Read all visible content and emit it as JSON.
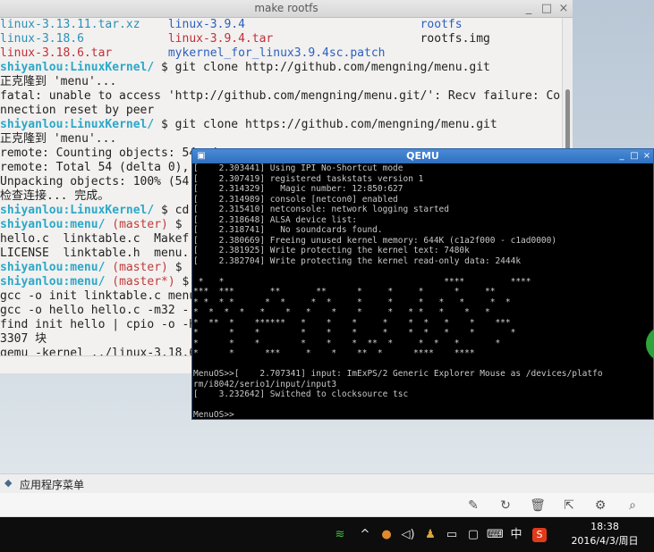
{
  "terminal": {
    "title": "make rootfs",
    "ls_rows": [
      [
        "linux-3.13.11.tar.xz",
        "linux-3.9.4",
        "rootfs"
      ],
      [
        "linux-3.18.6",
        "linux-3.9.4.tar",
        "rootfs.img"
      ],
      [
        "linux-3.18.6.tar",
        "mykernel_for_linux3.9.4sc.patch",
        ""
      ]
    ],
    "lines": [
      {
        "user": "shiyanlou",
        "path": "LinuxKernel/",
        "branch": "",
        "cmd": " $ git clone http://github.com/mengning/menu.git"
      },
      {
        "text": "正克隆到 'menu'..."
      },
      {
        "text": "fatal: unable to access 'http://github.com/mengning/menu.git/': Recv failure: Co"
      },
      {
        "text": "nnection reset by peer"
      },
      {
        "user": "shiyanlou",
        "path": "LinuxKernel/",
        "branch": "",
        "cmd": " $ git clone https://github.com/mengning/menu.git"
      },
      {
        "text": "正克隆到 'menu'..."
      },
      {
        "text": "remote: Counting objects: 54, done."
      },
      {
        "text": "remote: Total 54 (delta 0),"
      },
      {
        "text": "Unpacking objects: 100% (54"
      },
      {
        "text": "检查连接... 完成。"
      },
      {
        "user": "shiyanlou",
        "path": "LinuxKernel/",
        "branch": "",
        "cmd": " $ cd"
      },
      {
        "user": "shiyanlou",
        "path": "menu/",
        "branch": "(master)",
        "cmd": " $"
      },
      {
        "text": "hello.c  linktable.c  Makef"
      },
      {
        "text": "LICENSE  linktable.h  menu."
      },
      {
        "user": "shiyanlou",
        "path": "menu/",
        "branch": "(master)",
        "cmd": " $ "
      },
      {
        "user": "shiyanlou",
        "path": "menu/",
        "branch": "(master*)",
        "cmd": " $ m"
      },
      {
        "text": "gcc -o init linktable.c menu"
      },
      {
        "text": "gcc -o hello hello.c -m32 -"
      },
      {
        "text": "find init hello | cpio -o -H"
      },
      {
        "text": "3307 块"
      },
      {
        "text": "qemu -kernel ../linux-3.18.6"
      }
    ]
  },
  "qemu": {
    "title": "QEMU",
    "boot_lines": [
      "[    2.303441] Using IPI No-Shortcut mode",
      "[    2.307419] registered taskstats version 1",
      "[    2.314329]   Magic number: 12:850:627",
      "[    2.314989] console [netcon0] enabled",
      "[    2.315410] netconsole: network logging started",
      "[    2.318648] ALSA device list:",
      "[    2.318741]   No soundcards found.",
      "[    2.380669] Freeing unused kernel memory: 644K (c1a2f000 - c1ad0000)",
      "[    2.381925] Write protecting the kernel text: 7480k",
      "[    2.382704] Write protecting the kernel read-only data: 2444k"
    ],
    "art_lines": [
      " *   *                                           ****         ****",
      "***  ***       **       **      *     *     *      *     **",
      "* *  * *      *  *     *  *     *     *     *   *   *     *  *",
      "*  *  *  *   *    *   *    *    *     *   * *   *    *   *",
      "*  **  *    ******   *    *    *     *    *  *   *    *    ***",
      "*      *    *        *    *    *     *    *  *   *    *       *",
      "*      *    *        *    *    *  **  *     *  *   *       *",
      "*      *      ***     *    *    **  *      ****    ****"
    ],
    "tail_lines": [
      "MenuOS>>[    2.707341] input: ImExPS/2 Generic Explorer Mouse as /devices/platfo",
      "rm/i8042/serio1/input/input3",
      "[    3.232642] Switched to clocksource tsc",
      "",
      "MenuOS>>_"
    ]
  },
  "appmenu": {
    "label": "应用程序菜单"
  },
  "tray": {
    "ime_label": "中",
    "clock_time": "18:38",
    "clock_date": "2016/4/3/周日"
  }
}
